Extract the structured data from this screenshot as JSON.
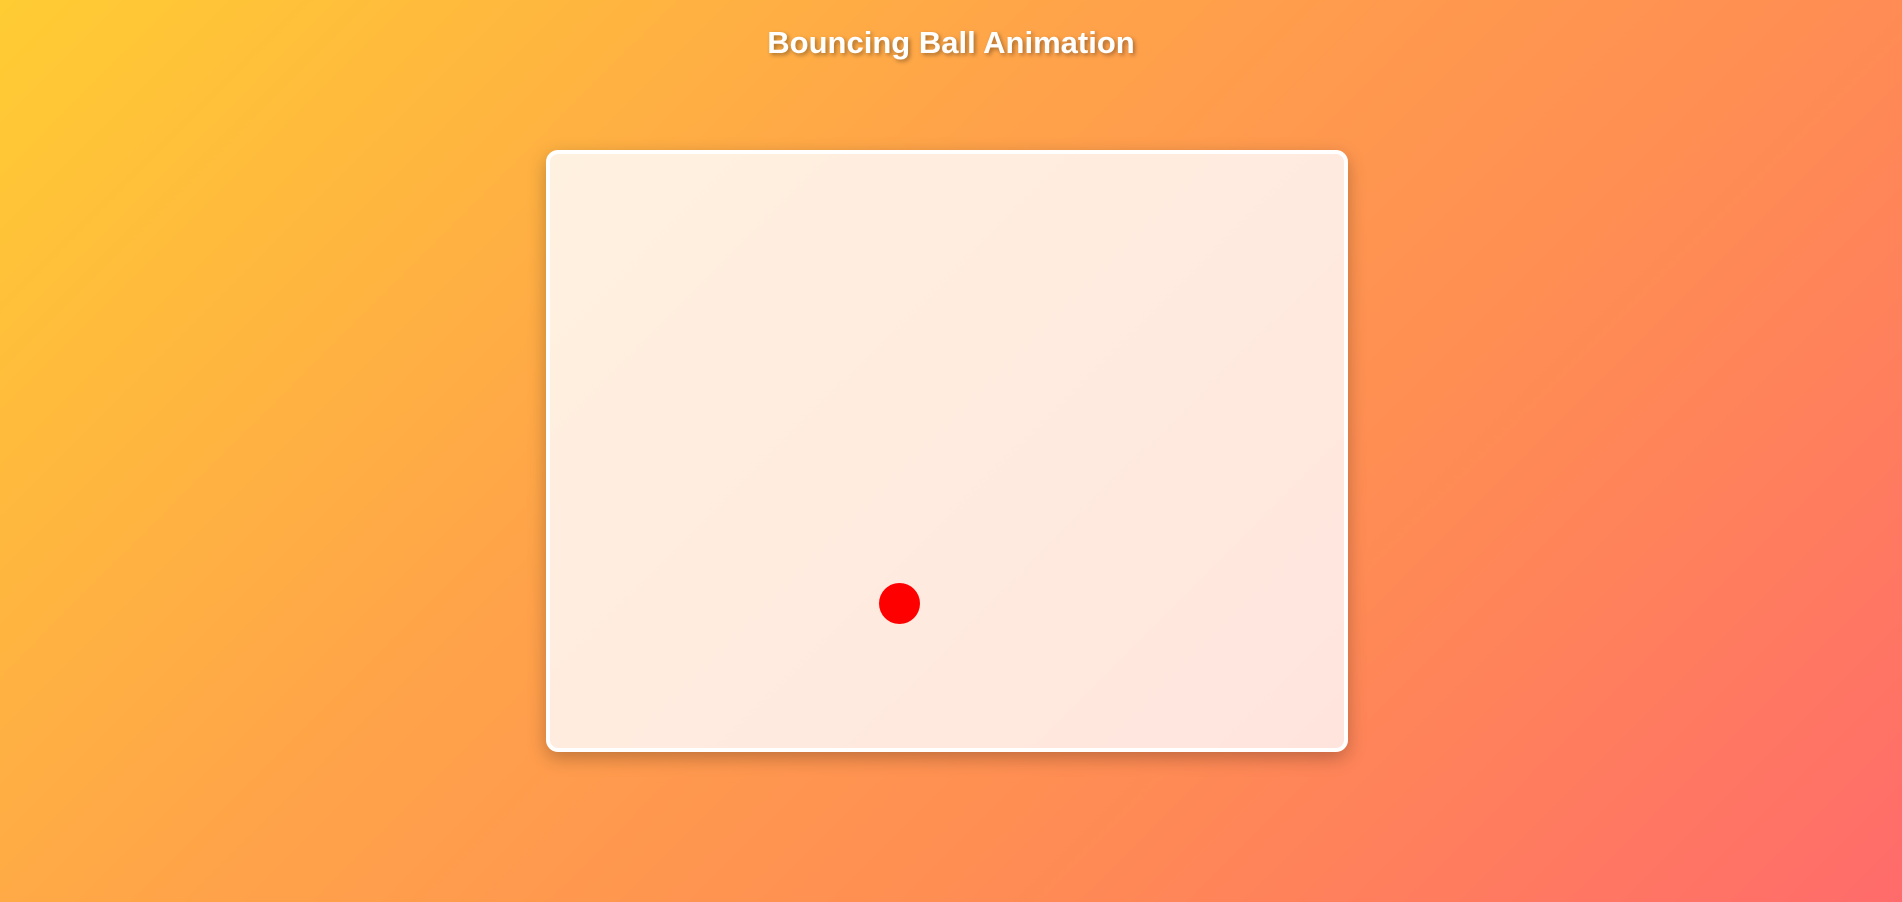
{
  "header": {
    "title": "Bouncing Ball Animation"
  },
  "stage": {
    "ball_color": "#ff0000",
    "border_color": "#ffffff"
  }
}
